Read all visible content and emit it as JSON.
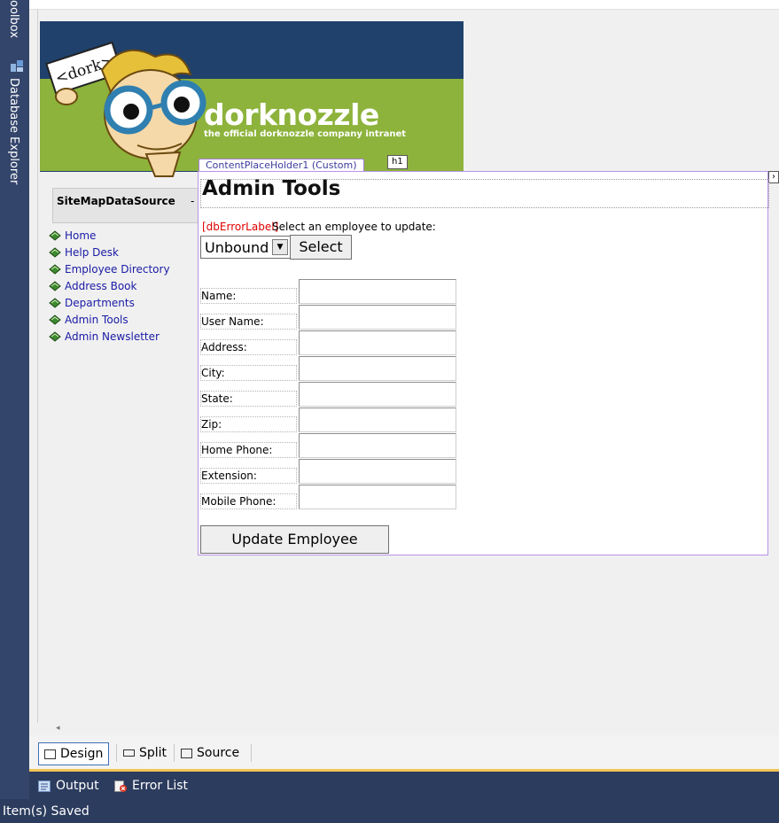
{
  "side": {
    "toolbox_label": "oolbox",
    "db_explorer_label": "Database Explorer"
  },
  "banner": {
    "brand": "dorknozzle",
    "tagline": "the official dorknozzle company intranet",
    "sign": "<dork>"
  },
  "sitemap_source": {
    "type": "SiteMapDataSource",
    "separator": "-",
    "id": "dorknozzleSiteMap"
  },
  "nav": {
    "items": [
      {
        "label": "Home"
      },
      {
        "label": "Help Desk"
      },
      {
        "label": "Employee Directory"
      },
      {
        "label": "Address Book"
      },
      {
        "label": "Departments"
      },
      {
        "label": "Admin Tools"
      },
      {
        "label": "Admin Newsletter"
      }
    ]
  },
  "content": {
    "placeholder_tab": "ContentPlaceHolder1 (Custom)",
    "h1_tag": "h1",
    "title": "Admin Tools",
    "error_label": "[dbErrorLabel]",
    "prompt": "Select an employee to update:",
    "dropdown_value": "Unbound",
    "select_button": "Select",
    "fields": [
      {
        "label": "Name:",
        "value": ""
      },
      {
        "label": "User Name:",
        "value": ""
      },
      {
        "label": "Address:",
        "value": ""
      },
      {
        "label": "City:",
        "value": ""
      },
      {
        "label": "State:",
        "value": ""
      },
      {
        "label": "Zip:",
        "value": ""
      },
      {
        "label": "Home Phone:",
        "value": ""
      },
      {
        "label": "Extension:",
        "value": ""
      },
      {
        "label": "Mobile Phone:",
        "value": ""
      }
    ],
    "update_button": "Update Employee"
  },
  "view_tabs": {
    "design": "Design",
    "split": "Split",
    "source": "Source",
    "active": "Design"
  },
  "tool_windows": {
    "output": "Output",
    "error_list": "Error List"
  },
  "status": {
    "text": "Item(s) Saved"
  },
  "colors": {
    "banner_blue": "#1f416b",
    "banner_green": "#8db33c",
    "ide_dark": "#2c3c5e",
    "placeholder_border": "#b893e6",
    "error_red": "#e00000",
    "tab_accent": "#f0c454"
  }
}
